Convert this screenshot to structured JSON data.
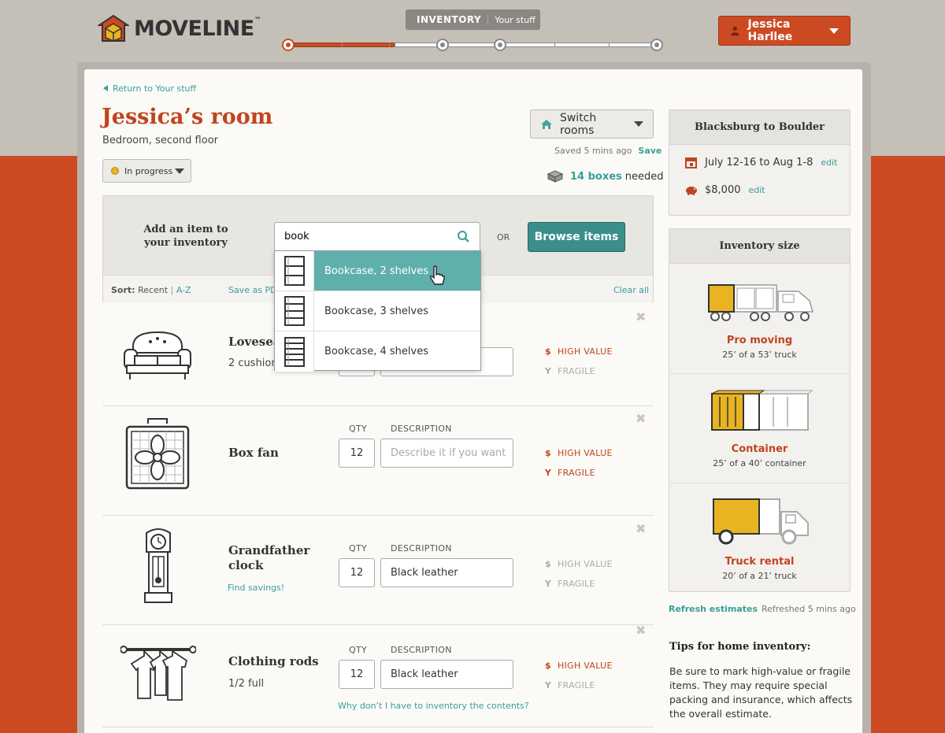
{
  "header": {
    "brand": "MOVELINE",
    "brand_tm": "™",
    "step_label": "INVENTORY",
    "step_sub": "Your stuff",
    "progress_fraction": 0.29,
    "user_name": "Jessica Harllee"
  },
  "room": {
    "back_link": "Return to Your stuff",
    "title": "Jessica’s room",
    "subtitle": "Bedroom, second floor",
    "status": "In progress",
    "switch_label": "Switch rooms",
    "saved_text": "Saved 5 mins ago",
    "save_link": "Save",
    "boxes_count": "14 boxes",
    "boxes_suffix": "needed"
  },
  "add": {
    "label": "Add an item to your inventory",
    "search_value": "book",
    "or": "OR",
    "browse": "Browse items",
    "sort_label": "Sort:",
    "sort_recent": "Recent",
    "sort_sep": "|",
    "sort_az": "A-Z",
    "save_pdf": "Save as PDF",
    "clear_all": "Clear all",
    "suggestions": [
      "Bookcase, 2 shelves",
      "Bookcase, 3 shelves",
      "Bookcase, 4 shelves"
    ]
  },
  "columns": {
    "qty": "QTY",
    "description": "DESCRIPTION",
    "high_value": "HIGH VALUE",
    "fragile": "FRAGILE"
  },
  "items": [
    {
      "name": "Loveseat",
      "sub": "2 cushions",
      "qty": "",
      "desc": "",
      "high_value": true,
      "fragile": false
    },
    {
      "name": "Box fan",
      "qty": "12",
      "desc_placeholder": "Describe it if you want",
      "high_value": true,
      "fragile": true
    },
    {
      "name": "Grandfather clock",
      "link": "Find savings!",
      "qty": "12",
      "desc": "Black leather",
      "high_value": false,
      "fragile": false
    },
    {
      "name": "Clothing rods",
      "sub": "1/2 full",
      "qty": "12",
      "desc": "Black leather",
      "link": "Why don’t I have to inventory the contents?",
      "high_value": true,
      "fragile": false
    }
  ],
  "sidebar": {
    "route": "Blacksburg to Boulder",
    "dates": "July 12-16 to Aug 1-8",
    "budget": "$8,000",
    "edit": "edit",
    "inventory_title": "Inventory size",
    "estimates": [
      {
        "title": "Pro moving",
        "sub": "25’ of a 53’ truck"
      },
      {
        "title": "Container",
        "sub": "25’ of a 40’ container"
      },
      {
        "title": "Truck rental",
        "sub": "20’ of a 21’ truck"
      }
    ],
    "refresh": "Refresh estimates",
    "refreshed": "Refreshed 5 mins ago",
    "tips_title": "Tips for home inventory:",
    "tips_body": "Be sure to mark high-value or fragile items. They may require special packing and insurance, which affects the overall estimate."
  },
  "colors": {
    "accent": "#cc4a22",
    "teal": "#3a9e9a",
    "highlight": "#5fb0ab",
    "yellow": "#e9b422"
  }
}
